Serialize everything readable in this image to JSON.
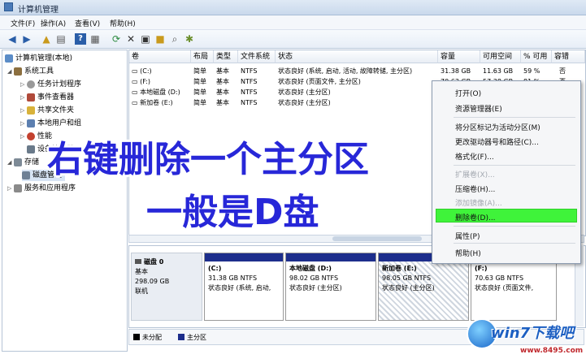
{
  "window": {
    "title": "计算机管理"
  },
  "menu": [
    "文件(F)",
    "操作(A)",
    "查看(V)",
    "帮助(H)"
  ],
  "toolbar_icons": [
    "back-icon",
    "forward-icon",
    "up-folder-icon",
    "show-tree-icon",
    "help-icon",
    "show-pane-icon",
    "refresh-icon",
    "delete-icon",
    "properties-icon",
    "open-icon",
    "search-icon",
    "settings-icon"
  ],
  "tree": {
    "root": "计算机管理(本地)",
    "items": [
      "系统工具",
      "任务计划程序",
      "事件查看器",
      "共享文件夹",
      "本地用户和组",
      "性能",
      "设备管理器",
      "存储",
      "磁盘管理",
      "服务和应用程序"
    ]
  },
  "table": {
    "headers": [
      "卷",
      "布局",
      "类型",
      "文件系统",
      "状态",
      "容量",
      "可用空间",
      "% 可用",
      "容错"
    ],
    "rows": [
      [
        "(C:)",
        "简单",
        "基本",
        "NTFS",
        "状态良好 (系统, 启动, 活动, 故障转储, 主分区)",
        "31.38 GB",
        "11.63 GB",
        "59 %",
        "否"
      ],
      [
        "(F:)",
        "简单",
        "基本",
        "NTFS",
        "状态良好 (页面文件, 主分区)",
        "70.63 GB",
        "57.38 GB",
        "81 %",
        "否"
      ],
      [
        "本地磁盘 (D:)",
        "简单",
        "基本",
        "NTFS",
        "状态良好 (主分区)",
        "",
        "",
        "",
        ""
      ],
      [
        "新加卷 (E:)",
        "简单",
        "基本",
        "NTFS",
        "状态良好 (主分区)",
        "",
        "",
        "",
        ""
      ]
    ]
  },
  "disk": {
    "name": "磁盘 0",
    "type": "基本",
    "size": "298.09 GB",
    "status": "联机",
    "partitions": [
      {
        "name": "(C:)",
        "size": "31.38 GB NTFS",
        "status": "状态良好 (系统, 启动,"
      },
      {
        "name": "本地磁盘 (D:)",
        "size": "98.02 GB NTFS",
        "status": "状态良好 (主分区)"
      },
      {
        "name": "新加卷 (E:)",
        "size": "98.05 GB NTFS",
        "status": "状态良好 (主分区)"
      },
      {
        "name": "(F:)",
        "size": "70.63 GB NTFS",
        "status": "状态良好 (页面文件,"
      }
    ]
  },
  "legend": {
    "unallocated": "未分配",
    "primary": "主分区"
  },
  "context_menu": {
    "items": [
      "打开(O)",
      "资源管理器(E)",
      "将分区标记为活动分区(M)",
      "更改驱动器号和路径(C)...",
      "格式化(F)...",
      "扩展卷(X)...",
      "压缩卷(H)...",
      "添加镜像(A)...",
      "删除卷(D)...",
      "属性(P)",
      "帮助(H)"
    ]
  },
  "overlay": {
    "line1": "右键删除一个主分区",
    "line2": "一般是D盘"
  },
  "watermark": {
    "brand": "win7下载吧",
    "url": "www.8495.com"
  },
  "colors": {
    "primary_partition": "#1d2e8c",
    "highlight": "#3ff33a",
    "overlay_text": "#2727d8"
  }
}
